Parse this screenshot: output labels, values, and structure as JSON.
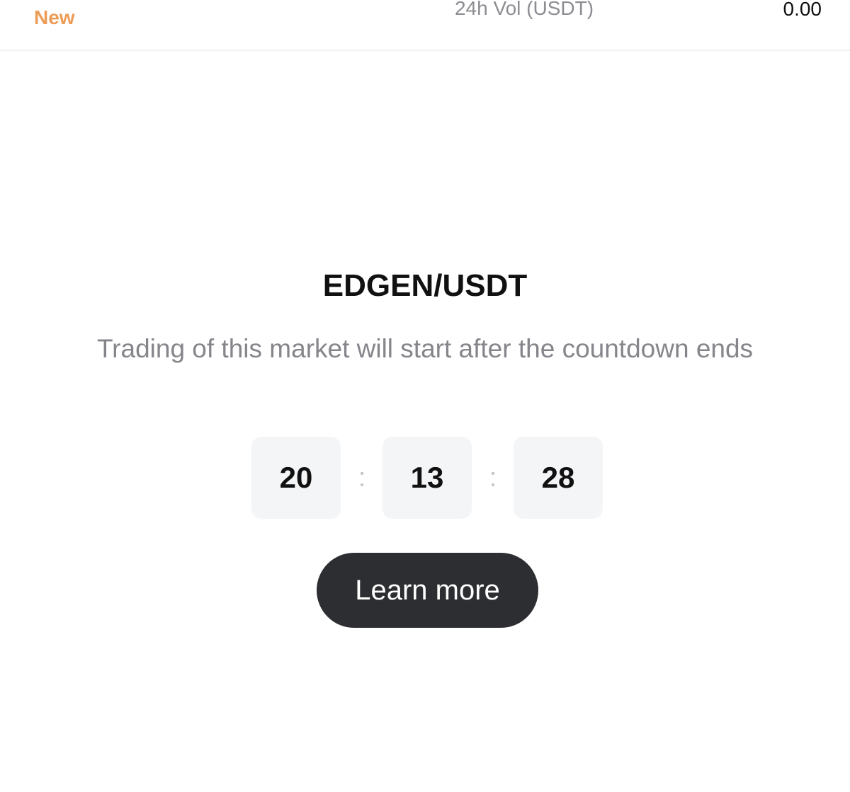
{
  "header": {
    "new_label": "New",
    "volume_label": "24h Vol (USDT)",
    "volume_value": "0.00"
  },
  "market": {
    "pair": "EDGEN/USDT",
    "message": "Trading of this market will start after the countdown ends"
  },
  "countdown": {
    "hours": "20",
    "minutes": "13",
    "seconds": "28",
    "separator": ":"
  },
  "actions": {
    "learn_more_label": "Learn more"
  },
  "colors": {
    "accent_orange": "#ec9c55",
    "button_dark": "#2d2e31",
    "muted_text": "#85858b",
    "box_background": "#f4f5f7"
  }
}
